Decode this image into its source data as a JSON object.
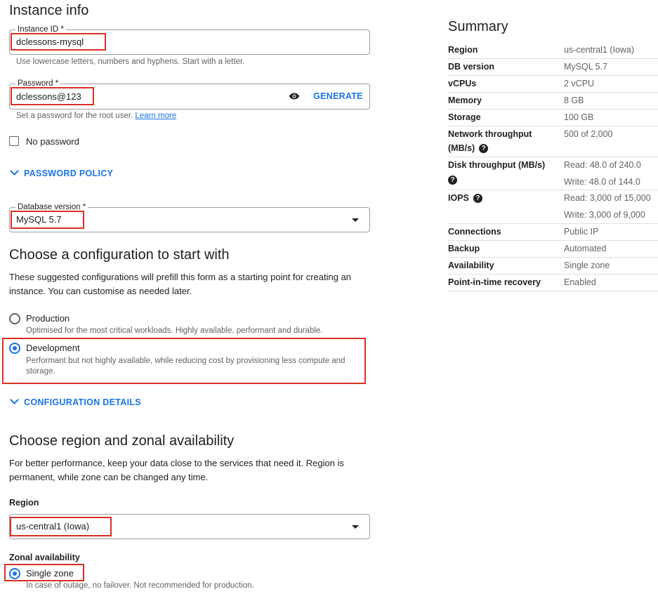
{
  "instance_info": {
    "title": "Instance info",
    "instance_id_label": "Instance ID *",
    "instance_id_value": "dclessons-mysql",
    "instance_id_hint": "Use lowercase letters, numbers and hyphens. Start with a letter.",
    "password_label": "Password *",
    "password_value": "dclessons@123",
    "generate_label": "GENERATE",
    "password_hint": "Set a password for the root user.",
    "learn_more": "Learn more",
    "no_password_label": "No password",
    "password_policy_label": "PASSWORD POLICY",
    "db_version_label": "Database version *",
    "db_version_value": "MySQL 5.7"
  },
  "configuration": {
    "title": "Choose a configuration to start with",
    "description": "These suggested configurations will prefill this form as a starting point for creating an instance. You can customise as needed later.",
    "options": [
      {
        "label": "Production",
        "desc": "Optimised for the most critical workloads. Highly available, performant and durable.",
        "selected": false
      },
      {
        "label": "Development",
        "desc": "Performant but not highly available, while reducing cost by provisioning less compute and storage.",
        "selected": true
      }
    ],
    "details_label": "CONFIGURATION DETAILS"
  },
  "region": {
    "title": "Choose region and zonal availability",
    "description": "For better performance, keep your data close to the services that need it. Region is permanent, while zone can be changed any time.",
    "region_label": "Region",
    "region_value": "us-central1 (Iowa)",
    "zonal_label": "Zonal availability",
    "zonal_option": "Single zone",
    "zonal_desc": "In case of outage, no failover. Not recommended for production."
  },
  "summary": {
    "title": "Summary",
    "region_k": "Region",
    "region_v": "us-central1 (Iowa)",
    "db_k": "DB version",
    "db_v": "MySQL 5.7",
    "vcpu_k": "vCPUs",
    "vcpu_v": "2 vCPU",
    "mem_k": "Memory",
    "mem_v": "8 GB",
    "storage_k": "Storage",
    "storage_v": "100 GB",
    "net_k1": "Network throughput",
    "net_k2": "(MB/s)",
    "net_v": "500 of 2,000",
    "disk_k": "Disk throughput (MB/s)",
    "disk_v1": "Read: 48.0 of 240.0",
    "disk_v2": "Write: 48.0 of 144.0",
    "iops_k": "IOPS",
    "iops_v1": "Read: 3,000 of 15,000",
    "iops_v2": "Write: 3,000 of 9,000",
    "conn_k": "Connections",
    "conn_v": "Public IP",
    "backup_k": "Backup",
    "backup_v": "Automated",
    "avail_k": "Availability",
    "avail_v": "Single zone",
    "pitr_k": "Point-in-time recovery",
    "pitr_v": "Enabled",
    "help_glyph": "?"
  }
}
